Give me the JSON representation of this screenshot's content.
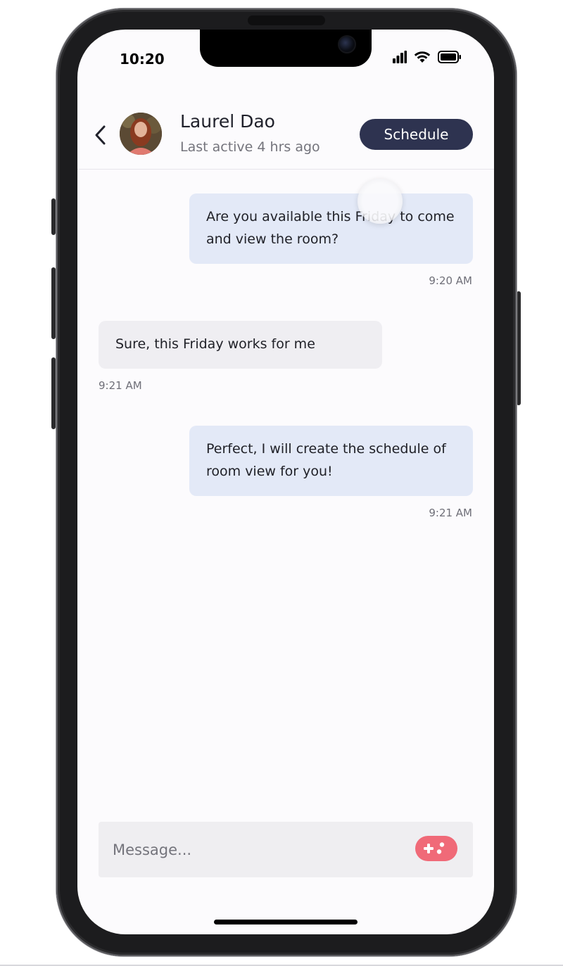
{
  "status_bar": {
    "time": "10:20"
  },
  "header": {
    "back_icon": "chevron-left-icon",
    "contact_name": "Laurel Dao",
    "contact_status": "Last active 4 hrs ago",
    "schedule_label": "Schedule"
  },
  "messages": [
    {
      "direction": "outgoing",
      "text": "Are you available this Friday to come and view the room?",
      "time": "9:20 AM"
    },
    {
      "direction": "incoming",
      "text": "Sure, this Friday works for me",
      "time": "9:21 AM"
    },
    {
      "direction": "outgoing",
      "text": "Perfect, I will create the schedule of room view for you!",
      "time": "9:21 AM"
    }
  ],
  "composer": {
    "placeholder": "Message...",
    "action_icon": "gamepad-icon"
  },
  "colors": {
    "accent_button": "#2e3350",
    "outgoing_bubble": "#e3e9f7",
    "incoming_bubble": "#efeef2",
    "game_button": "#f06a78"
  }
}
